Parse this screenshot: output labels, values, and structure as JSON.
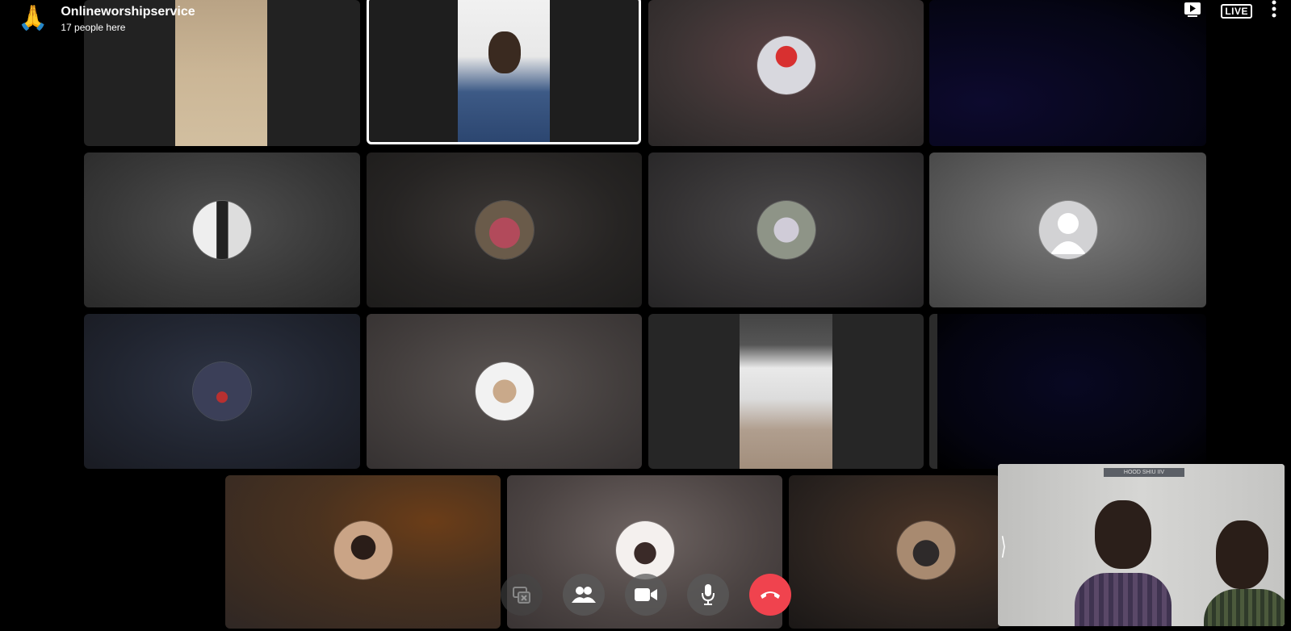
{
  "header": {
    "logo_glyph": "🙏",
    "group_name": "Onlineworshipservice",
    "people_here": "17 people here"
  },
  "top_right": {
    "live_label": "LIVE"
  },
  "controls": {
    "end_call_color": "#f0434e"
  },
  "self_view": {
    "nameplate": "HOOD  SHIU  IIV"
  },
  "navigation": {
    "next_glyph": "⟩"
  }
}
